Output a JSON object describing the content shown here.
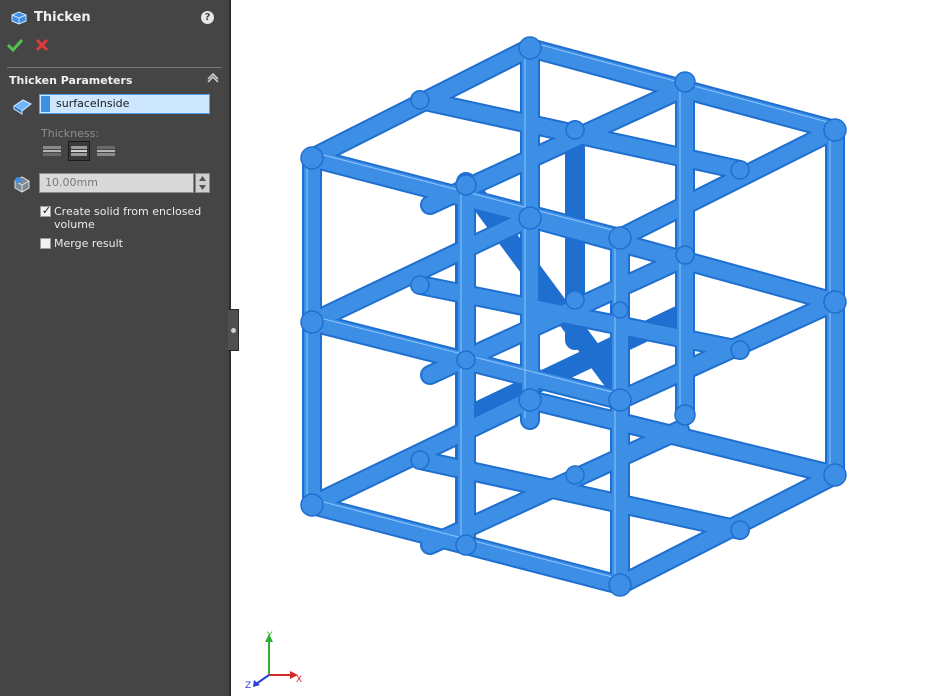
{
  "feature": {
    "title": "Thicken",
    "help_icon": "?",
    "icons": {
      "feature": "thicken-icon",
      "ok": "checkmark-icon",
      "cancel": "close-icon",
      "help": "help-icon"
    }
  },
  "group": {
    "title": "Thicken Parameters",
    "face_selection": "surfaceInside",
    "thickness_label": "Thickness:",
    "thickness_side_options": [
      "Thicken Side 1",
      "Thicken Both Sides",
      "Thicken Side 2"
    ],
    "thickness_side_selected": 1,
    "thickness_value": "10.00mm",
    "create_solid_label": "Create solid from enclosed volume",
    "create_solid_checked": true,
    "merge_label": "Merge result",
    "merge_checked": false
  },
  "triad": {
    "x": "X",
    "y": "Y",
    "z": "Z"
  },
  "colors": {
    "panel": "#454545",
    "model": "#3d8fe6",
    "edge": "#1f6fd0",
    "accent": "#5aa3e8"
  }
}
